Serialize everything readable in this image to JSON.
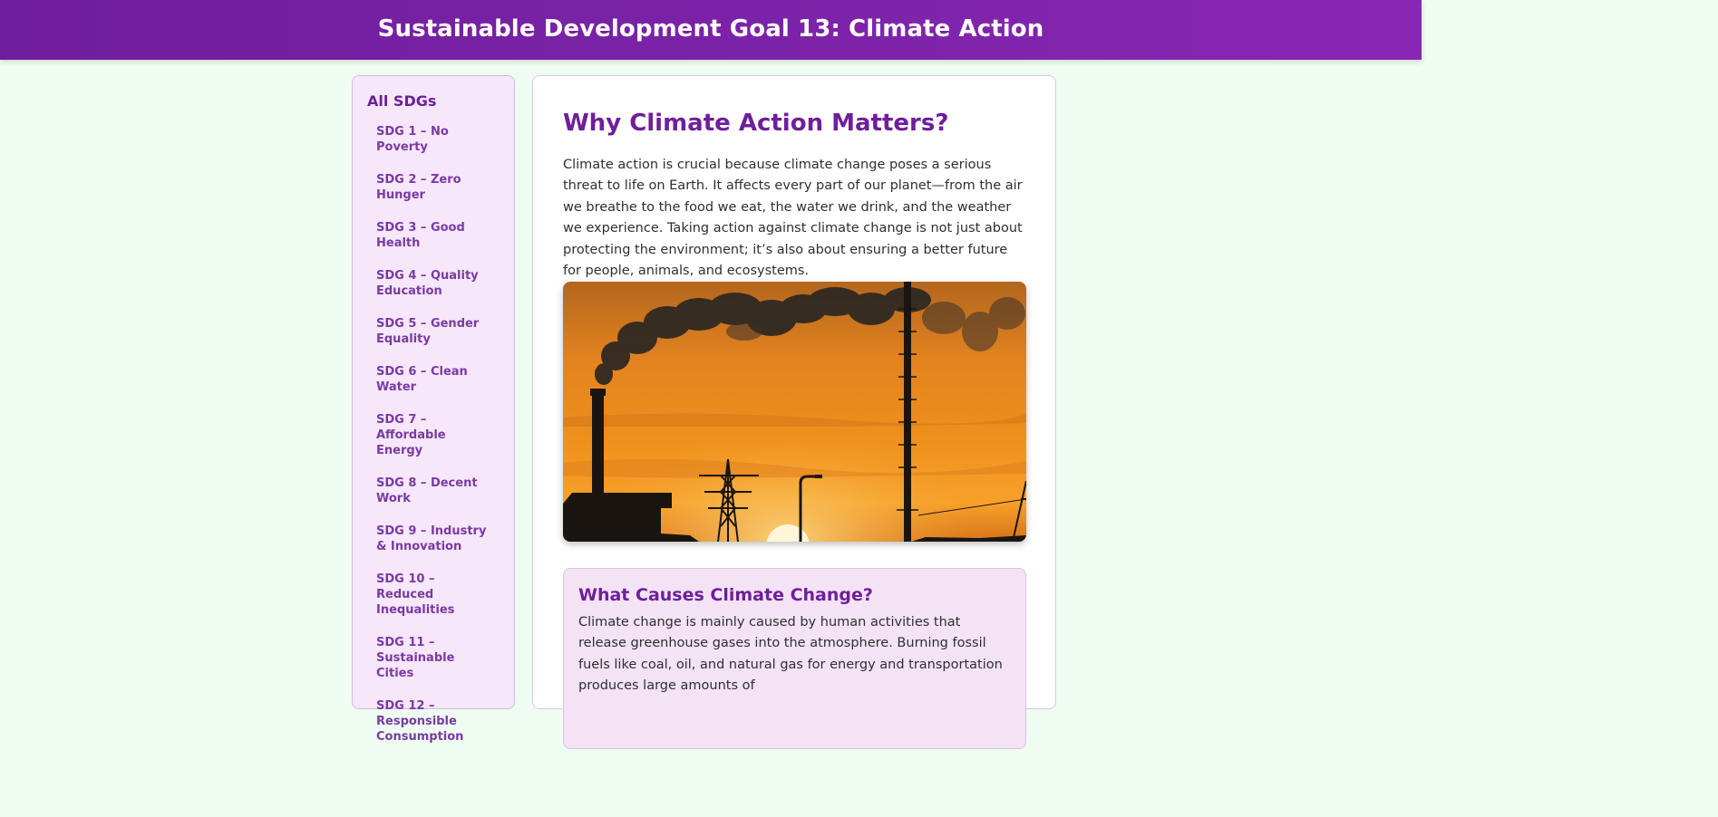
{
  "header": {
    "title": "Sustainable Development Goal 13: Climate Action"
  },
  "sidebar": {
    "heading": "All SDGs",
    "items": [
      {
        "label": "SDG 1 – No Poverty"
      },
      {
        "label": "SDG 2 – Zero Hunger"
      },
      {
        "label": "SDG 3 – Good Health"
      },
      {
        "label": "SDG 4 – Quality Education"
      },
      {
        "label": "SDG 5 – Gender Equality"
      },
      {
        "label": "SDG 6 – Clean Water"
      },
      {
        "label": "SDG 7 – Affordable Energy"
      },
      {
        "label": "SDG 8 – Decent Work"
      },
      {
        "label": "SDG 9 – Industry & Innovation"
      },
      {
        "label": "SDG 10 – Reduced Inequalities"
      },
      {
        "label": "SDG 11 – Sustainable Cities"
      },
      {
        "label": "SDG 12 – Responsible Consumption"
      }
    ]
  },
  "main": {
    "title": "Why Climate Action Matters?",
    "intro": "Climate action is crucial because climate change poses a serious threat to life on Earth. It affects every part of our planet—from the air we breathe to the food we eat, the water we drink, and the weather we experience. Taking action against climate change is not just about protecting the environment; it’s also about ensuring a better future for people, animals, and ecosystems.",
    "causes": {
      "heading": "What Causes Climate Change?",
      "text": "Climate change is mainly caused by human activities that release greenhouse gases into the atmosphere. Burning fossil fuels like coal, oil, and natural gas for energy and transportation produces large amounts of"
    }
  },
  "colors": {
    "accent": "#6f1e9c",
    "page_bg": "#eefcf1",
    "sidebar_bg": "#f6e7fb",
    "card_bg": "#f3e3f5"
  }
}
